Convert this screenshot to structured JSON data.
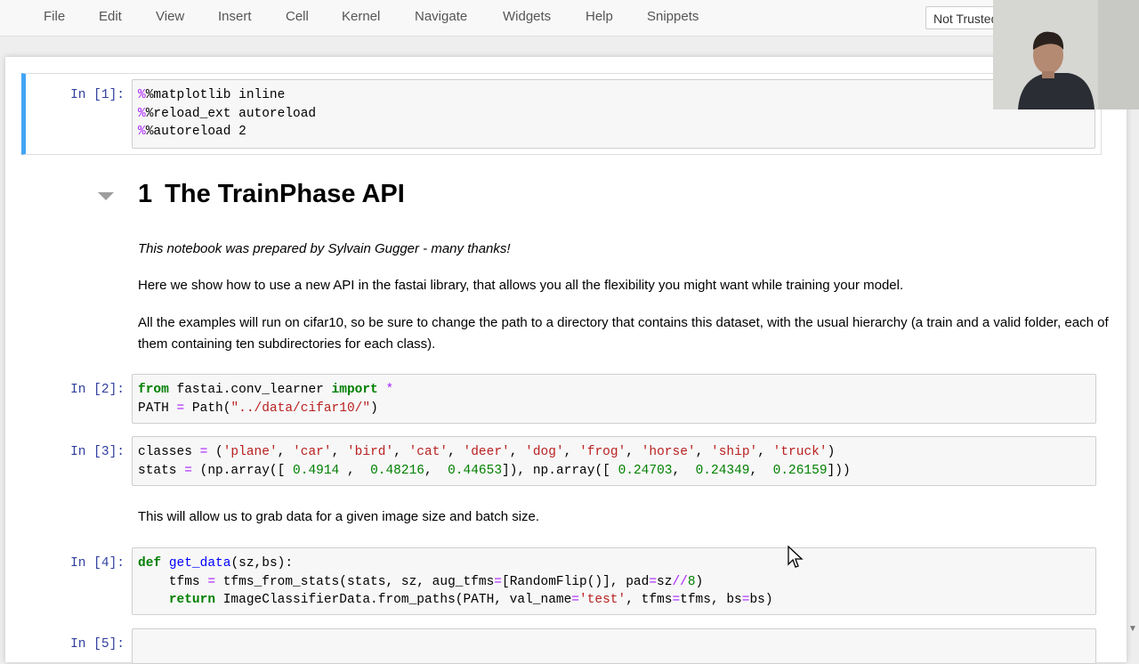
{
  "menu": {
    "items": [
      "File",
      "Edit",
      "View",
      "Insert",
      "Cell",
      "Kernel",
      "Navigate",
      "Widgets",
      "Help",
      "Snippets"
    ],
    "trust_badge": "Not Trusted"
  },
  "cells": {
    "c1": {
      "prompt": "In [1]:",
      "lines": [
        "%matplotlib inline",
        "%reload_ext autoreload",
        "%autoreload 2"
      ]
    },
    "heading": {
      "number": "1",
      "title": "The TrainPhase API"
    },
    "md1": "This notebook was prepared by Sylvain Gugger - many thanks!",
    "md2": "Here we show how to use a new API in the fastai library, that allows you all the flexibility you might want while training your model.",
    "md3": "All the examples will run on cifar10, so be sure to change the path to a directory that contains this dataset, with the usual hierarchy (a train and a valid folder, each of them containing ten subdirectories for each class).",
    "c2": {
      "prompt": "In [2]:"
    },
    "c3": {
      "prompt": "In [3]:"
    },
    "md4": "This will allow us to grab data for a given image size and batch size.",
    "c4": {
      "prompt": "In [4]:"
    },
    "c5": {
      "prompt": "In [5]:"
    }
  },
  "colors": {
    "selected_border": "#42a5f5",
    "prompt": "#303f9f",
    "keyword": "#008000",
    "string": "#ba2121"
  }
}
